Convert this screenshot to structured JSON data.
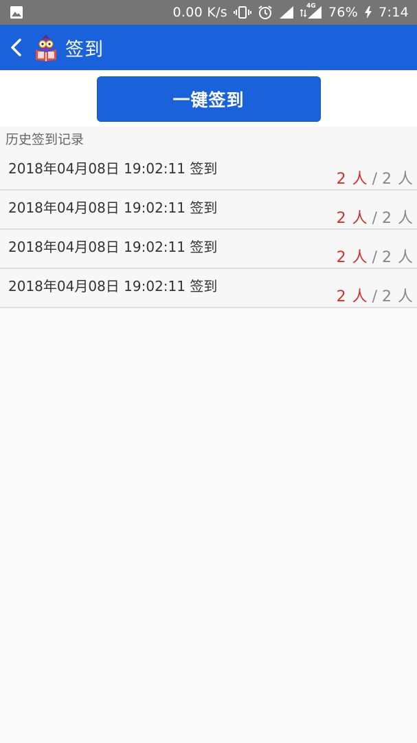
{
  "status_bar": {
    "net_speed": "0.00 K/s",
    "network_type": "4G",
    "battery": "76%",
    "time": "7:14",
    "icons": [
      "image-icon",
      "vibrate-icon",
      "alarm-icon",
      "signal-icon",
      "signal-4g-icon",
      "charging-icon"
    ]
  },
  "app_bar": {
    "title": "签到",
    "back_icon": "chevron-left-icon",
    "logo_icon": "reading-owl-icon"
  },
  "actions": {
    "one_click_signin": "一键签到"
  },
  "history": {
    "section_title": "历史签到记录",
    "records": [
      {
        "text": "2018年04月08日 19:02:11 签到",
        "signed": "2 人",
        "separator": "/",
        "total": "2 人"
      },
      {
        "text": "2018年04月08日 19:02:11 签到",
        "signed": "2 人",
        "separator": "/",
        "total": "2 人"
      },
      {
        "text": "2018年04月08日 19:02:11 签到",
        "signed": "2 人",
        "separator": "/",
        "total": "2 人"
      },
      {
        "text": "2018年04月08日 19:02:11 签到",
        "signed": "2 人",
        "separator": "/",
        "total": "2 人"
      }
    ]
  },
  "colors": {
    "primary": "#1a62dc",
    "status_bar": "#757575",
    "count_highlight": "#d32f2f",
    "background": "#fafafa"
  }
}
